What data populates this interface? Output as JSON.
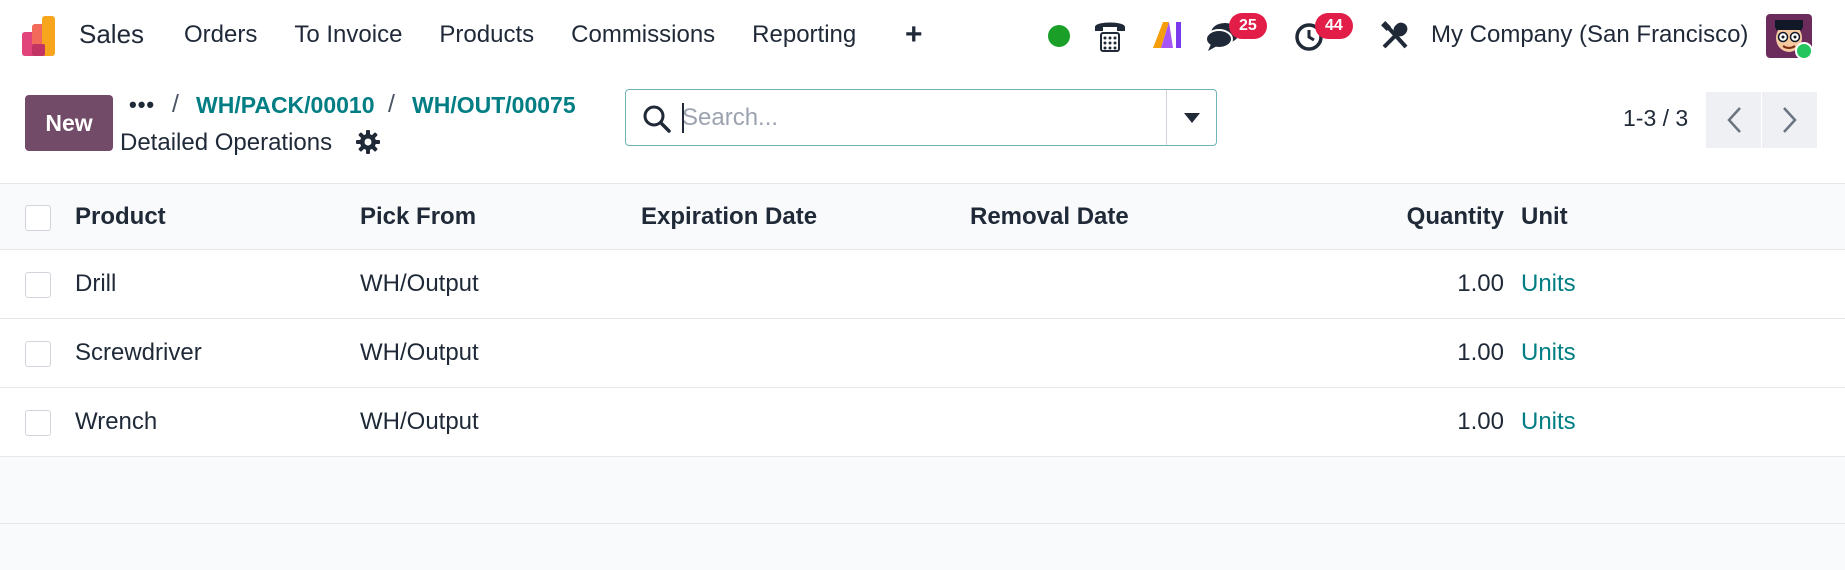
{
  "app": {
    "name": "Sales"
  },
  "menu": {
    "items": [
      "Orders",
      "To Invoice",
      "Products",
      "Commissions",
      "Reporting"
    ],
    "plus": "+"
  },
  "systray": {
    "messages_count": "25",
    "activities_count": "44",
    "company": "My Company (San Francisco)",
    "status_color": "#1a9f29"
  },
  "control": {
    "new_label": "New",
    "more_label": "•••",
    "breadcrumbs": [
      "WH/PACK/00010",
      "WH/OUT/00075"
    ],
    "separator": "/",
    "view_title": "Detailed Operations",
    "search_placeholder": "Search...",
    "pager": "1-3 / 3"
  },
  "table": {
    "headers": {
      "product": "Product",
      "pick_from": "Pick From",
      "expiration": "Expiration Date",
      "removal": "Removal Date",
      "quantity": "Quantity",
      "unit": "Unit"
    },
    "rows": [
      {
        "product": "Drill",
        "pick_from": "WH/Output",
        "expiration": "",
        "removal": "",
        "quantity": "1.00",
        "unit": "Units"
      },
      {
        "product": "Screwdriver",
        "pick_from": "WH/Output",
        "expiration": "",
        "removal": "",
        "quantity": "1.00",
        "unit": "Units"
      },
      {
        "product": "Wrench",
        "pick_from": "WH/Output",
        "expiration": "",
        "removal": "",
        "quantity": "1.00",
        "unit": "Units"
      }
    ]
  },
  "colors": {
    "brand": "#714b67",
    "link": "#017e84",
    "badge": "#e11d48"
  }
}
